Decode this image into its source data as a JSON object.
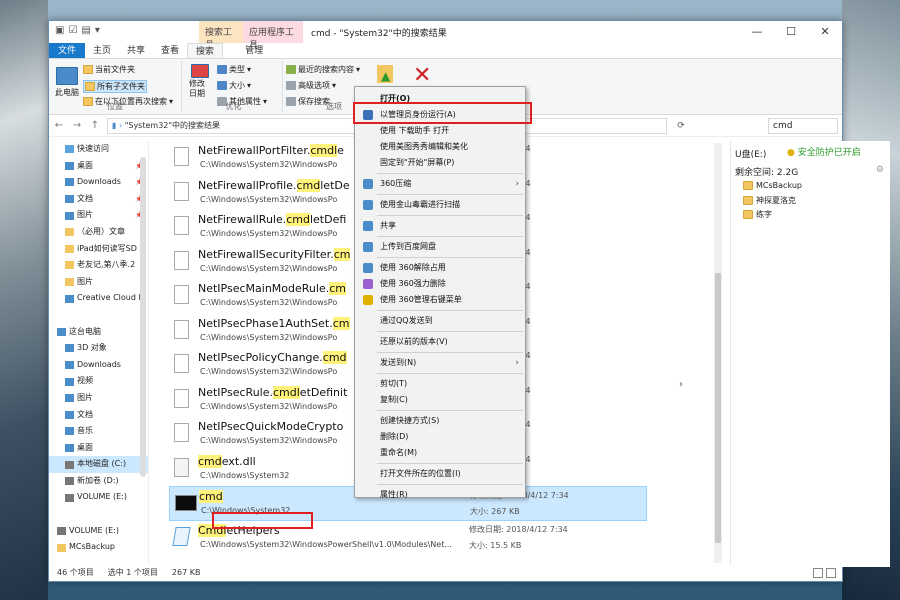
{
  "window": {
    "title": "cmd - \"System32\"中的搜索结果",
    "ctx_group1": "搜索工具",
    "ctx_group2": "应用程序工具",
    "minimize": "—",
    "maximize": "☐",
    "close": "✕"
  },
  "tabs": [
    {
      "label": "文件"
    },
    {
      "label": "主页"
    },
    {
      "label": "共享"
    },
    {
      "label": "查看"
    },
    {
      "label": "搜索"
    },
    {
      "label": "管理"
    }
  ],
  "ribbon": {
    "pc_label": "此电脑",
    "current_folder": "当前文件夹",
    "all_subfolders": "所有子文件夹",
    "search_again": "在以下位置再次搜索",
    "location_group": "位置",
    "modified_date": "修改日期",
    "kind": "类型",
    "size": "大小",
    "other_props": "其他属性",
    "optimize_group": "优化",
    "recent_searches": "最近的搜索内容",
    "advanced_options": "高级选项",
    "save_search": "保存搜索",
    "options_group": "选项"
  },
  "address": {
    "path": "\"System32\"中的搜索结果",
    "back": "←",
    "forward": "→",
    "up": "↑",
    "refresh": "⟳",
    "search_value": "cmd",
    "search_clear": "✕"
  },
  "nav": [
    {
      "label": "快速访问",
      "icon": "star-icon"
    },
    {
      "label": "桌面",
      "icon": "desktop-icon",
      "pin": true
    },
    {
      "label": "Downloads",
      "icon": "download-icon",
      "pin": true
    },
    {
      "label": "文档",
      "icon": "document-icon",
      "pin": true
    },
    {
      "label": "图片",
      "icon": "picture-icon",
      "pin": true
    },
    {
      "label": "（必用）文章",
      "icon": "folder-icon"
    },
    {
      "label": "iPad如何读写SD",
      "icon": "folder-icon"
    },
    {
      "label": "老友记,第八季.2",
      "icon": "folder-icon"
    },
    {
      "label": "图片",
      "icon": "folder-icon"
    },
    {
      "label": "Creative Cloud F",
      "icon": "cloud-icon"
    },
    {
      "label": "",
      "icon": ""
    },
    {
      "label": "这台电脑",
      "icon": "computer-icon"
    },
    {
      "label": "3D 对象",
      "icon": "cube-icon"
    },
    {
      "label": "Downloads",
      "icon": "download-icon"
    },
    {
      "label": "视频",
      "icon": "video-icon"
    },
    {
      "label": "图片",
      "icon": "picture-icon"
    },
    {
      "label": "文档",
      "icon": "document-icon"
    },
    {
      "label": "音乐",
      "icon": "music-icon"
    },
    {
      "label": "桌面",
      "icon": "desktop-icon"
    },
    {
      "label": "本地磁盘 (C:)",
      "icon": "drive-icon"
    },
    {
      "label": "新加卷 (D:)",
      "icon": "drive-icon"
    },
    {
      "label": "VOLUME (E:)",
      "icon": "drive-icon"
    },
    {
      "label": "",
      "icon": ""
    },
    {
      "label": "VOLUME (E:)",
      "icon": "drive-icon"
    },
    {
      "label": "MCsBackup",
      "icon": "folder-icon"
    }
  ],
  "files": [
    {
      "pre": "NetFirewallPortFilter.",
      "hl": "cmdl",
      "post": "e",
      "path": "C:\\Windows\\System32\\WindowsPo",
      "date": "2018/4/12 7:34",
      "size": "KB",
      "type": "doc"
    },
    {
      "pre": "NetFirewallProfile.",
      "hl": "cmd",
      "post": "letDe",
      "path": "C:\\Windows\\System32\\WindowsPo",
      "date": "2018/4/12 7:34",
      "size": "KB",
      "type": "doc"
    },
    {
      "pre": "NetFirewallRule.",
      "hl": "cmd",
      "post": "letDefi",
      "path": "C:\\Windows\\System32\\WindowsPo",
      "date": "2018/4/12 7:34",
      "size": "KB",
      "type": "doc"
    },
    {
      "pre": "NetFirewallSecurityFilter.",
      "hl": "cm",
      "post": "",
      "path": "C:\\Windows\\System32\\WindowsPo",
      "date": "2018/4/12 7:34",
      "size": "KB",
      "type": "doc"
    },
    {
      "pre": "NetIPsecMainModeRule.",
      "hl": "cm",
      "post": "",
      "path": "C:\\Windows\\System32\\WindowsPo",
      "date": "2018/4/12 7:34",
      "size": "KB",
      "type": "doc"
    },
    {
      "pre": "NetIPsecPhase1AuthSet.",
      "hl": "cm",
      "post": "",
      "path": "C:\\Windows\\System32\\WindowsPo",
      "date": "2018/4/12 7:34",
      "size": "KB",
      "type": "doc"
    },
    {
      "pre": "NetIPsecPolicyChange.",
      "hl": "cmd",
      "post": "",
      "path": "C:\\Windows\\System32\\WindowsPo",
      "date": "2018/4/12 7:34",
      "size": "字节",
      "type": "doc"
    },
    {
      "pre": "NetIPsecRule.",
      "hl": "cmdl",
      "post": "etDefinit",
      "path": "C:\\Windows\\System32\\WindowsPo",
      "date": "2018/4/12 7:34",
      "size": "KB",
      "type": "doc"
    },
    {
      "pre": "NetIPsecQuickModeCrypto",
      "hl": "",
      "post": "",
      "path": "C:\\Windows\\System32\\WindowsPo",
      "date": "2018/4/12 7:34",
      "size": "KB",
      "type": "doc"
    },
    {
      "pre": "",
      "hl": "cmd",
      "post": "ext.dll",
      "path": "C:\\Windows\\System32",
      "date": "2018/4/12 7:34",
      "size": "KB",
      "type": "dll"
    },
    {
      "pre": "",
      "hl": "cmd",
      "post": "",
      "path": "C:\\Windows\\System32",
      "date": "修改日期: 2018/4/12 7:34",
      "size": "大小: 267 KB",
      "type": "cmd"
    },
    {
      "pre": "",
      "hl": "Cmdl",
      "post": "etHelpers",
      "path": "C:\\Windows\\System32\\WindowsPowerShell\\v1.0\\Modules\\Net...",
      "date": "修改日期: 2018/4/12 7:34",
      "size": "大小: 15.5 KB",
      "type": "ps"
    }
  ],
  "preview": {
    "drive": "U盘(E:)",
    "safe": "安全防护已开启",
    "free": "剩余空间: 2.2G",
    "items": [
      "MCsBackup",
      "神探夏洛克",
      "练字"
    ]
  },
  "status": {
    "count": "46 个项目",
    "selected": "选中 1 个项目",
    "size": "267 KB"
  },
  "menu": [
    {
      "label": "打开(O)",
      "bold": true
    },
    {
      "label": "以管理员身份运行(A)",
      "icon": "shield-icon"
    },
    {
      "label": "使用 下载助手 打开"
    },
    {
      "label": "使用美图秀秀编辑和美化"
    },
    {
      "label": "固定到\"开始\"屏幕(P)"
    },
    {
      "sep": true
    },
    {
      "label": "360压缩",
      "icon": "archive-icon",
      "sub": true
    },
    {
      "sep": true
    },
    {
      "label": "使用金山毒霸进行扫描",
      "icon": "scan-icon"
    },
    {
      "sep": true
    },
    {
      "label": "共享",
      "icon": "share-icon"
    },
    {
      "sep": true
    },
    {
      "label": "上传到百度网盘",
      "icon": "cloud-icon"
    },
    {
      "sep": true
    },
    {
      "label": "使用 360解除占用",
      "icon": "unlock-icon"
    },
    {
      "label": "使用 360强力删除",
      "icon": "delete-icon"
    },
    {
      "label": "使用 360管理右键菜单",
      "icon": "menu-manage-icon"
    },
    {
      "sep": true
    },
    {
      "label": "通过QQ发送到"
    },
    {
      "sep": true
    },
    {
      "label": "还原以前的版本(V)"
    },
    {
      "sep": true
    },
    {
      "label": "发送到(N)",
      "sub": true
    },
    {
      "sep": true
    },
    {
      "label": "剪切(T)"
    },
    {
      "label": "复制(C)"
    },
    {
      "sep": true
    },
    {
      "label": "创建快捷方式(S)"
    },
    {
      "label": "删除(D)"
    },
    {
      "label": "重命名(M)"
    },
    {
      "sep": true
    },
    {
      "label": "打开文件所在的位置(I)"
    },
    {
      "sep": true
    },
    {
      "label": "属性(R)"
    }
  ]
}
